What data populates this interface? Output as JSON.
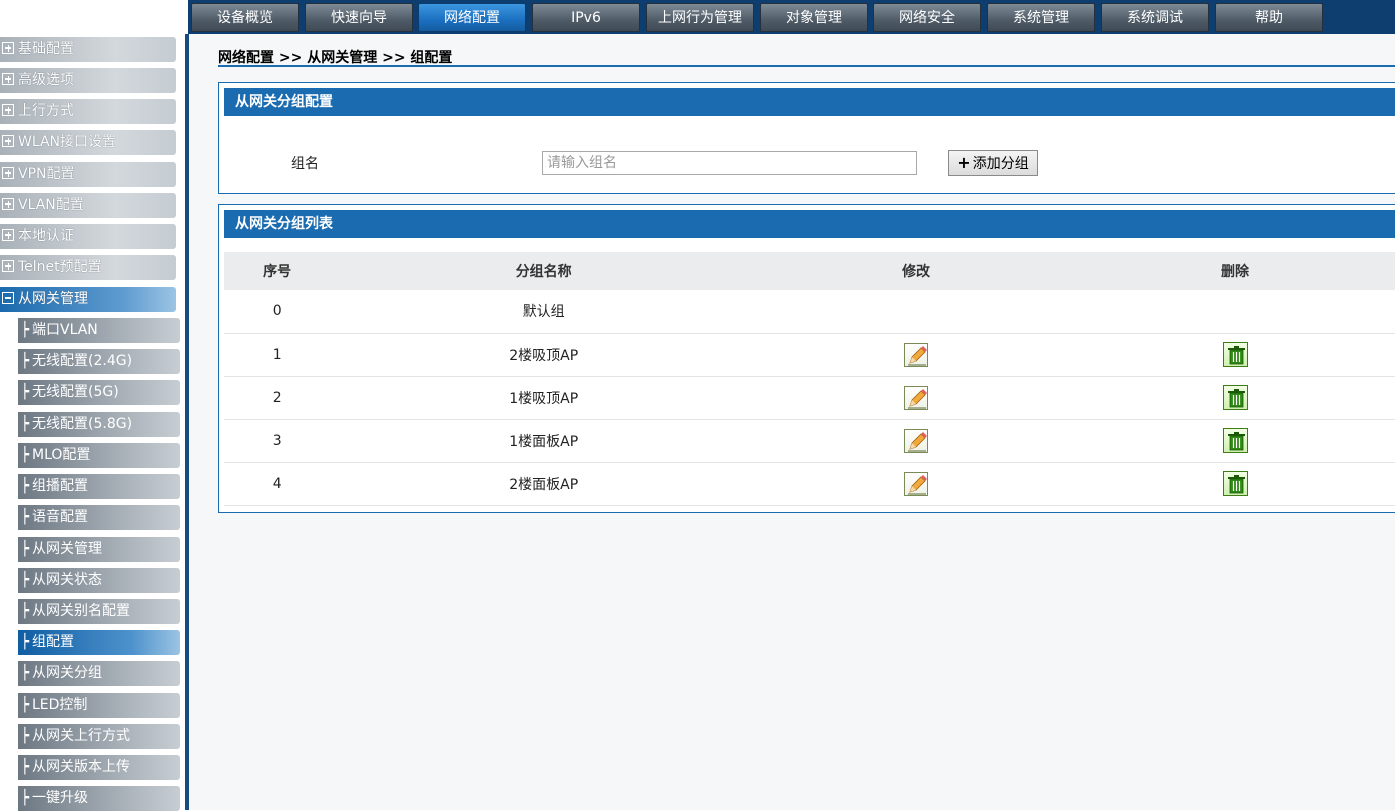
{
  "topnav": {
    "tabs": [
      {
        "label": "设备概览"
      },
      {
        "label": "快速向导"
      },
      {
        "label": "网络配置",
        "active": true
      },
      {
        "label": "IPv6"
      },
      {
        "label": "上网行为管理"
      },
      {
        "label": "对象管理"
      },
      {
        "label": "网络安全"
      },
      {
        "label": "系统管理"
      },
      {
        "label": "系统调试"
      },
      {
        "label": "帮助"
      }
    ]
  },
  "sidebar": {
    "items": [
      {
        "label": "基础配置"
      },
      {
        "label": "高级选项"
      },
      {
        "label": "上行方式"
      },
      {
        "label": "WLAN接口设置"
      },
      {
        "label": "VPN配置"
      },
      {
        "label": "VLAN配置"
      },
      {
        "label": "本地认证"
      },
      {
        "label": "Telnet预配置"
      },
      {
        "label": "从网关管理",
        "open": true
      }
    ],
    "subitems": [
      {
        "label": "端口VLAN"
      },
      {
        "label": "无线配置(2.4G)"
      },
      {
        "label": "无线配置(5G)"
      },
      {
        "label": "无线配置(5.8G)"
      },
      {
        "label": "MLO配置"
      },
      {
        "label": "组播配置"
      },
      {
        "label": "语音配置"
      },
      {
        "label": "从网关管理"
      },
      {
        "label": "从网关状态"
      },
      {
        "label": "从网关别名配置"
      },
      {
        "label": "组配置",
        "active": true
      },
      {
        "label": "从网关分组"
      },
      {
        "label": "LED控制"
      },
      {
        "label": "从网关上行方式"
      },
      {
        "label": "从网关版本上传"
      },
      {
        "label": "一键升级"
      }
    ]
  },
  "main": {
    "breadcrumb": "网络配置 >> 从网关管理 >> 组配置",
    "config_panel": {
      "title": "从网关分组配置",
      "group_label": "组名",
      "group_placeholder": "请输入组名",
      "add_button": "添加分组",
      "add_icon": "plus-icon"
    },
    "list_panel": {
      "title": "从网关分组列表",
      "columns": [
        "序号",
        "分组名称",
        "修改",
        "删除"
      ],
      "edit_icon": "pencil-icon",
      "delete_icon": "trash-icon",
      "rows": [
        {
          "index": "0",
          "name": "默认组",
          "editable": false
        },
        {
          "index": "1",
          "name": "2楼吸顶AP",
          "editable": true
        },
        {
          "index": "2",
          "name": "1楼吸顶AP",
          "editable": true
        },
        {
          "index": "3",
          "name": "1楼面板AP",
          "editable": true
        },
        {
          "index": "4",
          "name": "2楼面板AP",
          "editable": true
        }
      ]
    }
  },
  "colors": {
    "header_blue": "#1a6bb0",
    "nav_dark": "#0e3d70"
  }
}
